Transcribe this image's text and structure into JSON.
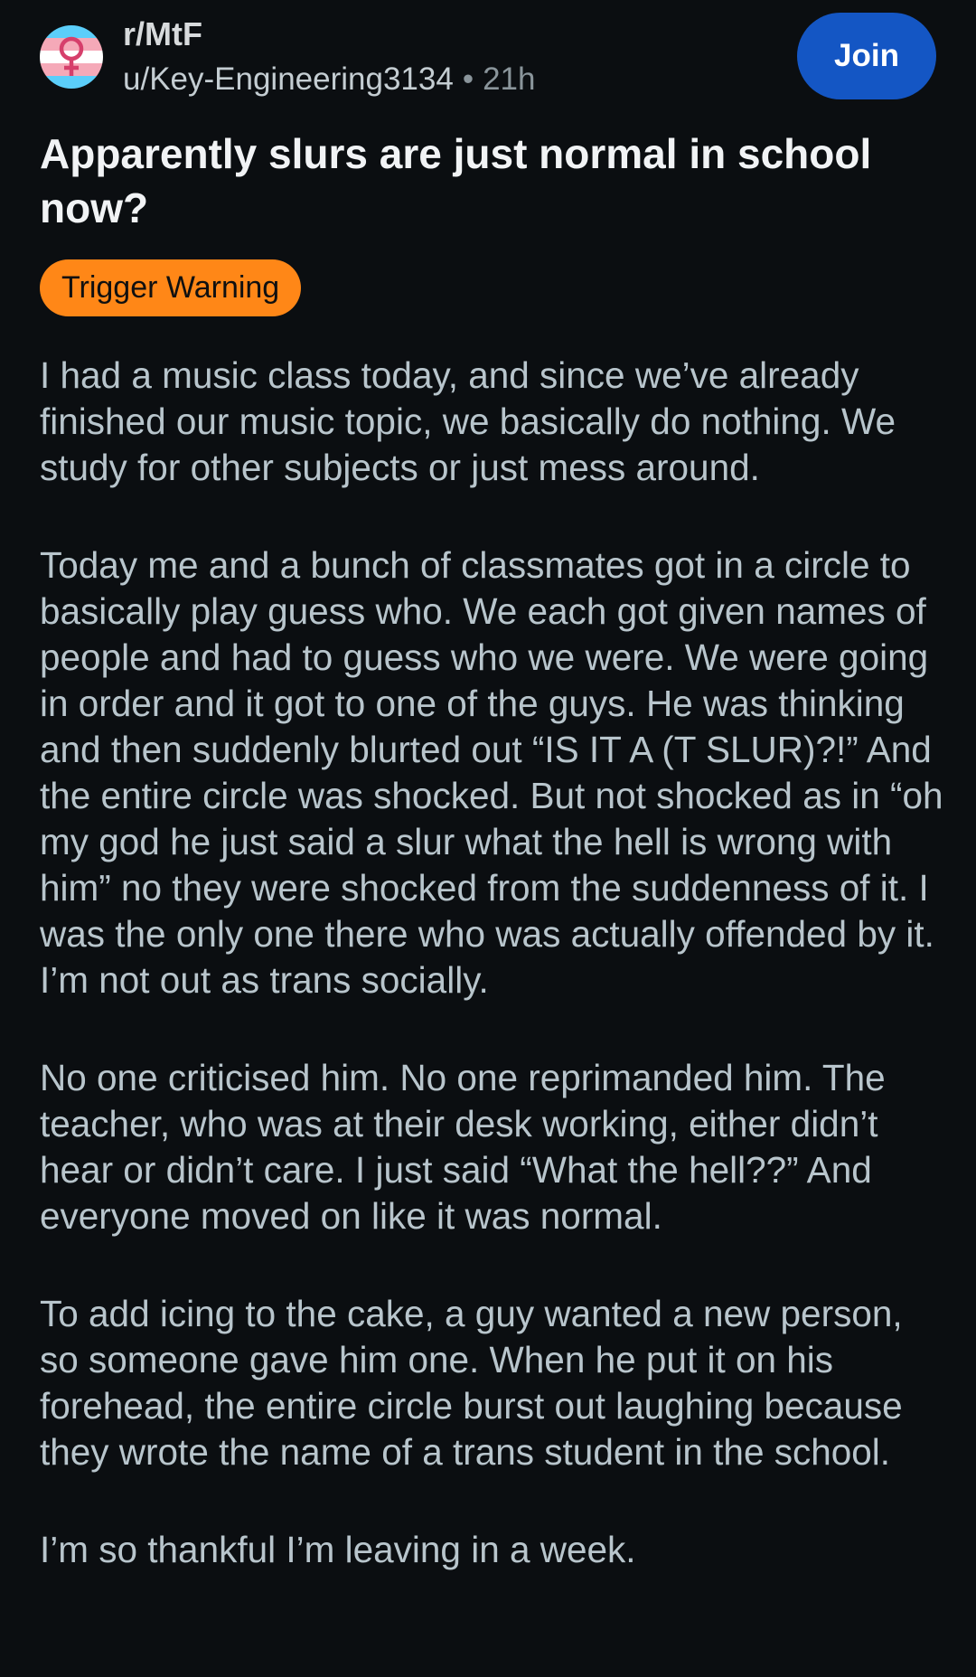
{
  "post": {
    "subreddit": "r/MtF",
    "author": "u/Key-Engineering3134",
    "separator": "•",
    "age": "21h",
    "join_label": "Join",
    "title": "Apparently slurs are just normal in school now?",
    "flair": "Trigger Warning",
    "paragraphs": [
      "I had a music class today, and since we’ve already finished our music topic, we basically do nothing. We study for other subjects or just mess around.",
      "Today me and a bunch of classmates got in a circle to basically play guess who. We each got given names of people and had to guess who we were. We were going in order and it got to one of the guys. He was thinking and then suddenly blurted out “IS IT A (T SLUR)?!” And the entire circle was shocked. But not shocked as in “oh my god he just said a slur what the hell is wrong with him” no they were shocked from the suddenness of it. I was the only one there who was actually offended by it. I’m not out as trans socially.",
      "No one criticised him. No one reprimanded him. The teacher, who was at their desk working, either didn’t hear or didn’t care. I just said “What the hell??” And everyone moved on like it was normal.",
      "To add icing to the cake, a guy wanted a new person, so someone gave him one. When he put it on his forehead, the entire circle burst out laughing because they wrote the name of a trans student in the school.",
      "I’m so thankful I’m leaving in a week."
    ]
  },
  "colors": {
    "background": "#0b0e11",
    "join_button": "#1456c4",
    "flair_background": "#ff8717",
    "body_text": "#b8c5cc",
    "title_text": "#f1f3f5"
  },
  "icons": {
    "subreddit_avatar": "trans-flag-female-symbol-icon"
  }
}
